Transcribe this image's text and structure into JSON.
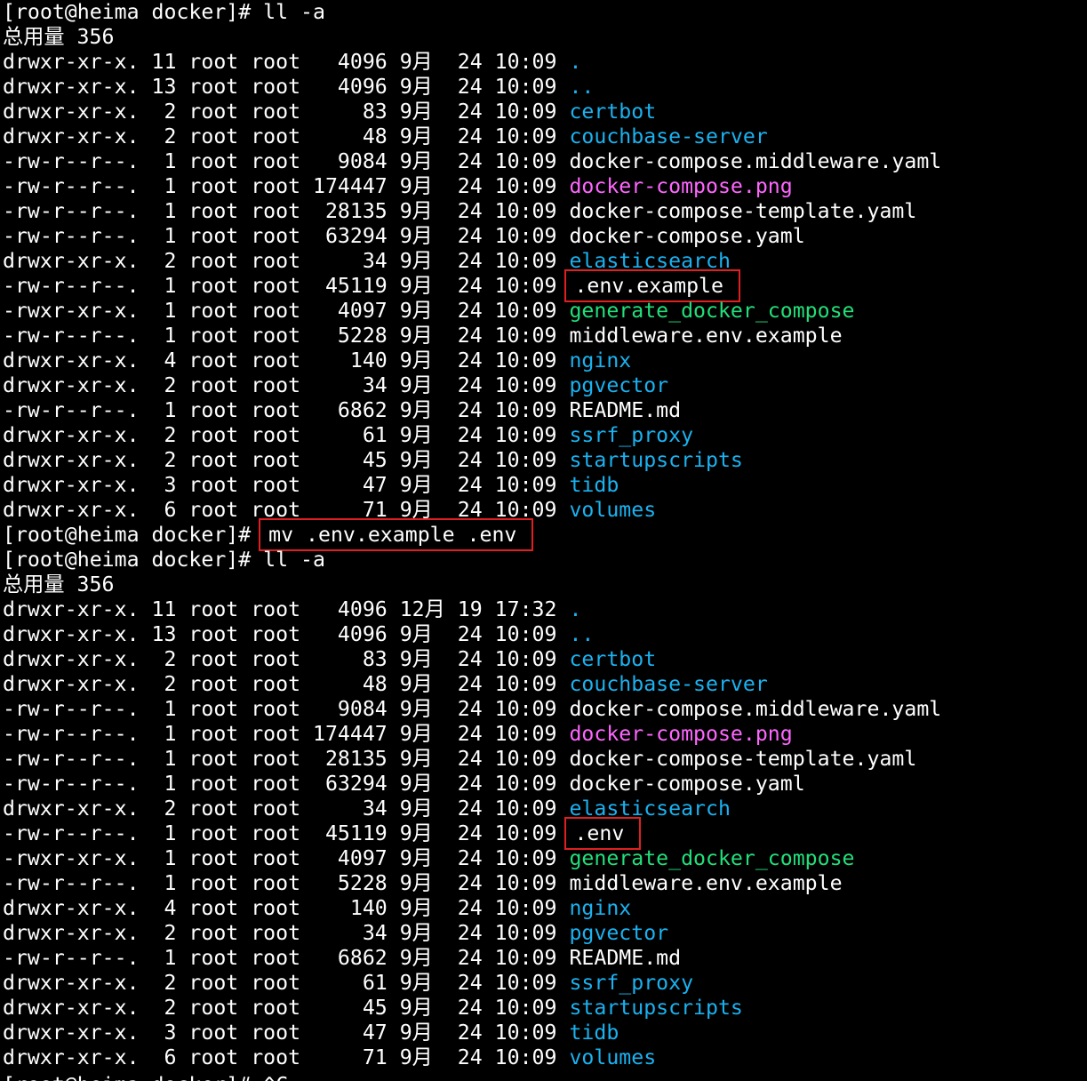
{
  "terminal": {
    "highlight_color": "#e02020",
    "colors": {
      "background": "#000000",
      "text": "#ffffff",
      "directory": "#1ab2f0",
      "executable": "#21e07a",
      "image": "#ff66ff"
    },
    "lines": [
      {
        "kind": "prompt",
        "prompt": "[root@heima docker]# ",
        "command": "ll -a"
      },
      {
        "kind": "text",
        "text": "总用量 356"
      },
      {
        "kind": "entry",
        "prefix": "drwxr-xr-x. 11 root root   4096 9月  24 10:09 ",
        "name": ".",
        "type": "dir"
      },
      {
        "kind": "entry",
        "prefix": "drwxr-xr-x. 13 root root   4096 9月  24 10:09 ",
        "name": "..",
        "type": "dir"
      },
      {
        "kind": "entry",
        "prefix": "drwxr-xr-x.  2 root root     83 9月  24 10:09 ",
        "name": "certbot",
        "type": "dir"
      },
      {
        "kind": "entry",
        "prefix": "drwxr-xr-x.  2 root root     48 9月  24 10:09 ",
        "name": "couchbase-server",
        "type": "dir"
      },
      {
        "kind": "entry",
        "prefix": "-rw-r--r--.  1 root root   9084 9月  24 10:09 ",
        "name": "docker-compose.middleware.yaml",
        "type": "file"
      },
      {
        "kind": "entry",
        "prefix": "-rw-r--r--.  1 root root 174447 9月  24 10:09 ",
        "name": "docker-compose.png",
        "type": "image"
      },
      {
        "kind": "entry",
        "prefix": "-rw-r--r--.  1 root root  28135 9月  24 10:09 ",
        "name": "docker-compose-template.yaml",
        "type": "file"
      },
      {
        "kind": "entry",
        "prefix": "-rw-r--r--.  1 root root  63294 9月  24 10:09 ",
        "name": "docker-compose.yaml",
        "type": "file"
      },
      {
        "kind": "entry",
        "prefix": "drwxr-xr-x.  2 root root     34 9月  24 10:09 ",
        "name": "elasticsearch",
        "type": "dir"
      },
      {
        "kind": "entry",
        "prefix": "-rw-r--r--.  1 root root  45119 9月  24 10:09 ",
        "name": ".env.example",
        "type": "file",
        "highlighted": true
      },
      {
        "kind": "entry",
        "prefix": "-rwxr-xr-x.  1 root root   4097 9月  24 10:09 ",
        "name": "generate_docker_compose",
        "type": "exec"
      },
      {
        "kind": "entry",
        "prefix": "-rw-r--r--.  1 root root   5228 9月  24 10:09 ",
        "name": "middleware.env.example",
        "type": "file"
      },
      {
        "kind": "entry",
        "prefix": "drwxr-xr-x.  4 root root    140 9月  24 10:09 ",
        "name": "nginx",
        "type": "dir"
      },
      {
        "kind": "entry",
        "prefix": "drwxr-xr-x.  2 root root     34 9月  24 10:09 ",
        "name": "pgvector",
        "type": "dir"
      },
      {
        "kind": "entry",
        "prefix": "-rw-r--r--.  1 root root   6862 9月  24 10:09 ",
        "name": "README.md",
        "type": "file"
      },
      {
        "kind": "entry",
        "prefix": "drwxr-xr-x.  2 root root     61 9月  24 10:09 ",
        "name": "ssrf_proxy",
        "type": "dir"
      },
      {
        "kind": "entry",
        "prefix": "drwxr-xr-x.  2 root root     45 9月  24 10:09 ",
        "name": "startupscripts",
        "type": "dir"
      },
      {
        "kind": "entry",
        "prefix": "drwxr-xr-x.  3 root root     47 9月  24 10:09 ",
        "name": "tidb",
        "type": "dir"
      },
      {
        "kind": "entry",
        "prefix": "drwxr-xr-x.  6 root root     71 9月  24 10:09 ",
        "name": "volumes",
        "type": "dir"
      },
      {
        "kind": "prompt",
        "prompt": "[root@heima docker]# ",
        "command": "mv .env.example .env",
        "highlighted": true
      },
      {
        "kind": "prompt",
        "prompt": "[root@heima docker]# ",
        "command": "ll -a"
      },
      {
        "kind": "text",
        "text": "总用量 356"
      },
      {
        "kind": "entry",
        "prefix": "drwxr-xr-x. 11 root root   4096 12月 19 17:32 ",
        "name": ".",
        "type": "dir"
      },
      {
        "kind": "entry",
        "prefix": "drwxr-xr-x. 13 root root   4096 9月  24 10:09 ",
        "name": "..",
        "type": "dir"
      },
      {
        "kind": "entry",
        "prefix": "drwxr-xr-x.  2 root root     83 9月  24 10:09 ",
        "name": "certbot",
        "type": "dir"
      },
      {
        "kind": "entry",
        "prefix": "drwxr-xr-x.  2 root root     48 9月  24 10:09 ",
        "name": "couchbase-server",
        "type": "dir"
      },
      {
        "kind": "entry",
        "prefix": "-rw-r--r--.  1 root root   9084 9月  24 10:09 ",
        "name": "docker-compose.middleware.yaml",
        "type": "file"
      },
      {
        "kind": "entry",
        "prefix": "-rw-r--r--.  1 root root 174447 9月  24 10:09 ",
        "name": "docker-compose.png",
        "type": "image"
      },
      {
        "kind": "entry",
        "prefix": "-rw-r--r--.  1 root root  28135 9月  24 10:09 ",
        "name": "docker-compose-template.yaml",
        "type": "file"
      },
      {
        "kind": "entry",
        "prefix": "-rw-r--r--.  1 root root  63294 9月  24 10:09 ",
        "name": "docker-compose.yaml",
        "type": "file"
      },
      {
        "kind": "entry",
        "prefix": "drwxr-xr-x.  2 root root     34 9月  24 10:09 ",
        "name": "elasticsearch",
        "type": "dir"
      },
      {
        "kind": "entry",
        "prefix": "-rw-r--r--.  1 root root  45119 9月  24 10:09 ",
        "name": ".env",
        "type": "file",
        "highlighted": true
      },
      {
        "kind": "entry",
        "prefix": "-rwxr-xr-x.  1 root root   4097 9月  24 10:09 ",
        "name": "generate_docker_compose",
        "type": "exec"
      },
      {
        "kind": "entry",
        "prefix": "-rw-r--r--.  1 root root   5228 9月  24 10:09 ",
        "name": "middleware.env.example",
        "type": "file"
      },
      {
        "kind": "entry",
        "prefix": "drwxr-xr-x.  4 root root    140 9月  24 10:09 ",
        "name": "nginx",
        "type": "dir"
      },
      {
        "kind": "entry",
        "prefix": "drwxr-xr-x.  2 root root     34 9月  24 10:09 ",
        "name": "pgvector",
        "type": "dir"
      },
      {
        "kind": "entry",
        "prefix": "-rw-r--r--.  1 root root   6862 9月  24 10:09 ",
        "name": "README.md",
        "type": "file"
      },
      {
        "kind": "entry",
        "prefix": "drwxr-xr-x.  2 root root     61 9月  24 10:09 ",
        "name": "ssrf_proxy",
        "type": "dir"
      },
      {
        "kind": "entry",
        "prefix": "drwxr-xr-x.  2 root root     45 9月  24 10:09 ",
        "name": "startupscripts",
        "type": "dir"
      },
      {
        "kind": "entry",
        "prefix": "drwxr-xr-x.  3 root root     47 9月  24 10:09 ",
        "name": "tidb",
        "type": "dir"
      },
      {
        "kind": "entry",
        "prefix": "drwxr-xr-x.  6 root root     71 9月  24 10:09 ",
        "name": "volumes",
        "type": "dir"
      },
      {
        "kind": "prompt",
        "prompt": "[root@heima docker]# ",
        "command": "^C",
        "partial": true
      }
    ]
  }
}
